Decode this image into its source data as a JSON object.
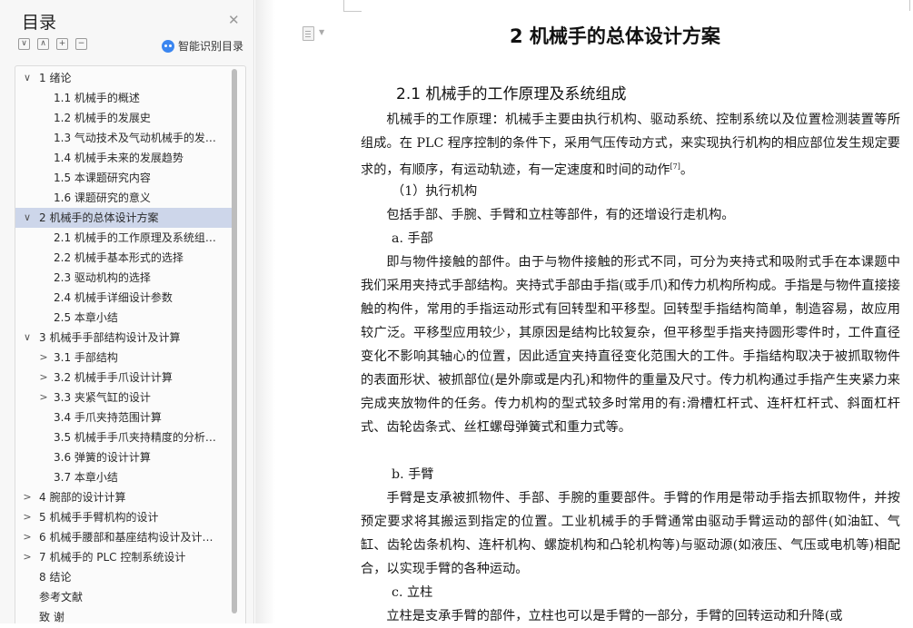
{
  "sidebar": {
    "title": "目录",
    "smart_label": "智能识别目录",
    "items": [
      {
        "label": "1  绪论",
        "level": 1,
        "caret": "∨"
      },
      {
        "label": "1.1  机械手的概述",
        "level": 2
      },
      {
        "label": "1.2  机械手的发展史",
        "level": 2
      },
      {
        "label": "1.3  气动技术及气动机械手的发…",
        "level": 2
      },
      {
        "label": "1.4  机械手未来的发展趋势",
        "level": 2
      },
      {
        "label": "1.5  本课题研究内容",
        "level": 2
      },
      {
        "label": "1.6  课题研究的意义",
        "level": 2
      },
      {
        "label": "2  机械手的总体设计方案",
        "level": 1,
        "caret": "∨",
        "active": true
      },
      {
        "label": "2.1  机械手的工作原理及系统组…",
        "level": 2
      },
      {
        "label": "2.2  机械手基本形式的选择",
        "level": 2
      },
      {
        "label": "2.3  驱动机构的选择",
        "level": 2
      },
      {
        "label": "2.4  机械手详细设计参数",
        "level": 2
      },
      {
        "label": "2.5  本章小结",
        "level": 2
      },
      {
        "label": "3  机械手手部结构设计及计算",
        "level": 1,
        "caret": "∨"
      },
      {
        "label": "3.1  手部结构",
        "level": 2,
        "caret": ">"
      },
      {
        "label": "3.2  机械手手爪设计计算",
        "level": 2,
        "caret": ">"
      },
      {
        "label": "3.3  夹紧气缸的设计",
        "level": 2,
        "caret": ">"
      },
      {
        "label": "3.4  手爪夹持范围计算",
        "level": 2
      },
      {
        "label": "3.5  机械手手爪夹持精度的分析…",
        "level": 2
      },
      {
        "label": "3.6  弹簧的设计计算",
        "level": 2
      },
      {
        "label": "3.7  本章小结",
        "level": 2
      },
      {
        "label": "4  腕部的设计计算",
        "level": 1,
        "caret": ">"
      },
      {
        "label": "5  机械手手臂机构的设计",
        "level": 1,
        "caret": ">"
      },
      {
        "label": "6  机械手腰部和基座结构设计及计…",
        "level": 1,
        "caret": ">"
      },
      {
        "label": "7  机械手的 PLC 控制系统设计",
        "level": 1,
        "caret": ">"
      },
      {
        "label": "8  结论",
        "level": 1
      },
      {
        "label": "参考文献",
        "level": 0
      },
      {
        "label": "致    谢",
        "level": 0
      }
    ]
  },
  "doc": {
    "chapter_title": "2  机械手的总体设计方案",
    "section_title": "2.1  机械手的工作原理及系统组成",
    "p1": "机械手的工作原理：机械手主要由执行机构、驱动系统、控制系统以及位置检测装置等所组成。在 PLC 程序控制的条件下，采用气压传动方式，来实现执行机构的相应部位发生规定要求的，有顺序，有运动轨迹，有一定速度和时间的动作",
    "p1_ref": "[7]",
    "p1_end": "。",
    "s1": "（1）执行机构",
    "p2": "包括手部、手腕、手臂和立柱等部件，有的还增设行走机构。",
    "s2": "a. 手部",
    "p3": "即与物件接触的部件。由于与物件接触的形式不同，可分为夹持式和吸附式手在本课题中我们采用夹持式手部结构。夹持式手部由手指(或手爪)和传力机构所构成。手指是与物件直接接触的构件，常用的手指运动形式有回转型和平移型。回转型手指结构简单，制造容易，故应用较广泛。平移型应用较少，其原因是结构比较复杂，但平移型手指夹持圆形零件时，工件直径变化不影响其轴心的位置，因此适宜夹持直径变化范围大的工件。手指结构取决于被抓取物件的表面形状、被抓部位(是外廓或是内孔)和物件的重量及尺寸。传力机构通过手指产生夹紧力来完成夹放物件的任务。传力机构的型式较多时常用的有:滑槽杠杆式、连杆杠杆式、斜面杠杆式、齿轮齿条式、丝杠螺母弹簧式和重力式等。",
    "s3": "b. 手臂",
    "p4": "手臂是支承被抓物件、手部、手腕的重要部件。手臂的作用是带动手指去抓取物件，并按预定要求将其搬运到指定的位置。工业机械手的手臂通常由驱动手臂运动的部件(如油缸、气缸、齿轮齿条机构、连杆机构、螺旋机构和凸轮机构等)与驱动源(如液压、气压或电机等)相配合，以实现手臂的各种运动。",
    "s4": "c. 立柱",
    "p5": "立柱是支承手臂的部件，立柱也可以是手臂的一部分，手臂的回转运动和升降(或"
  }
}
